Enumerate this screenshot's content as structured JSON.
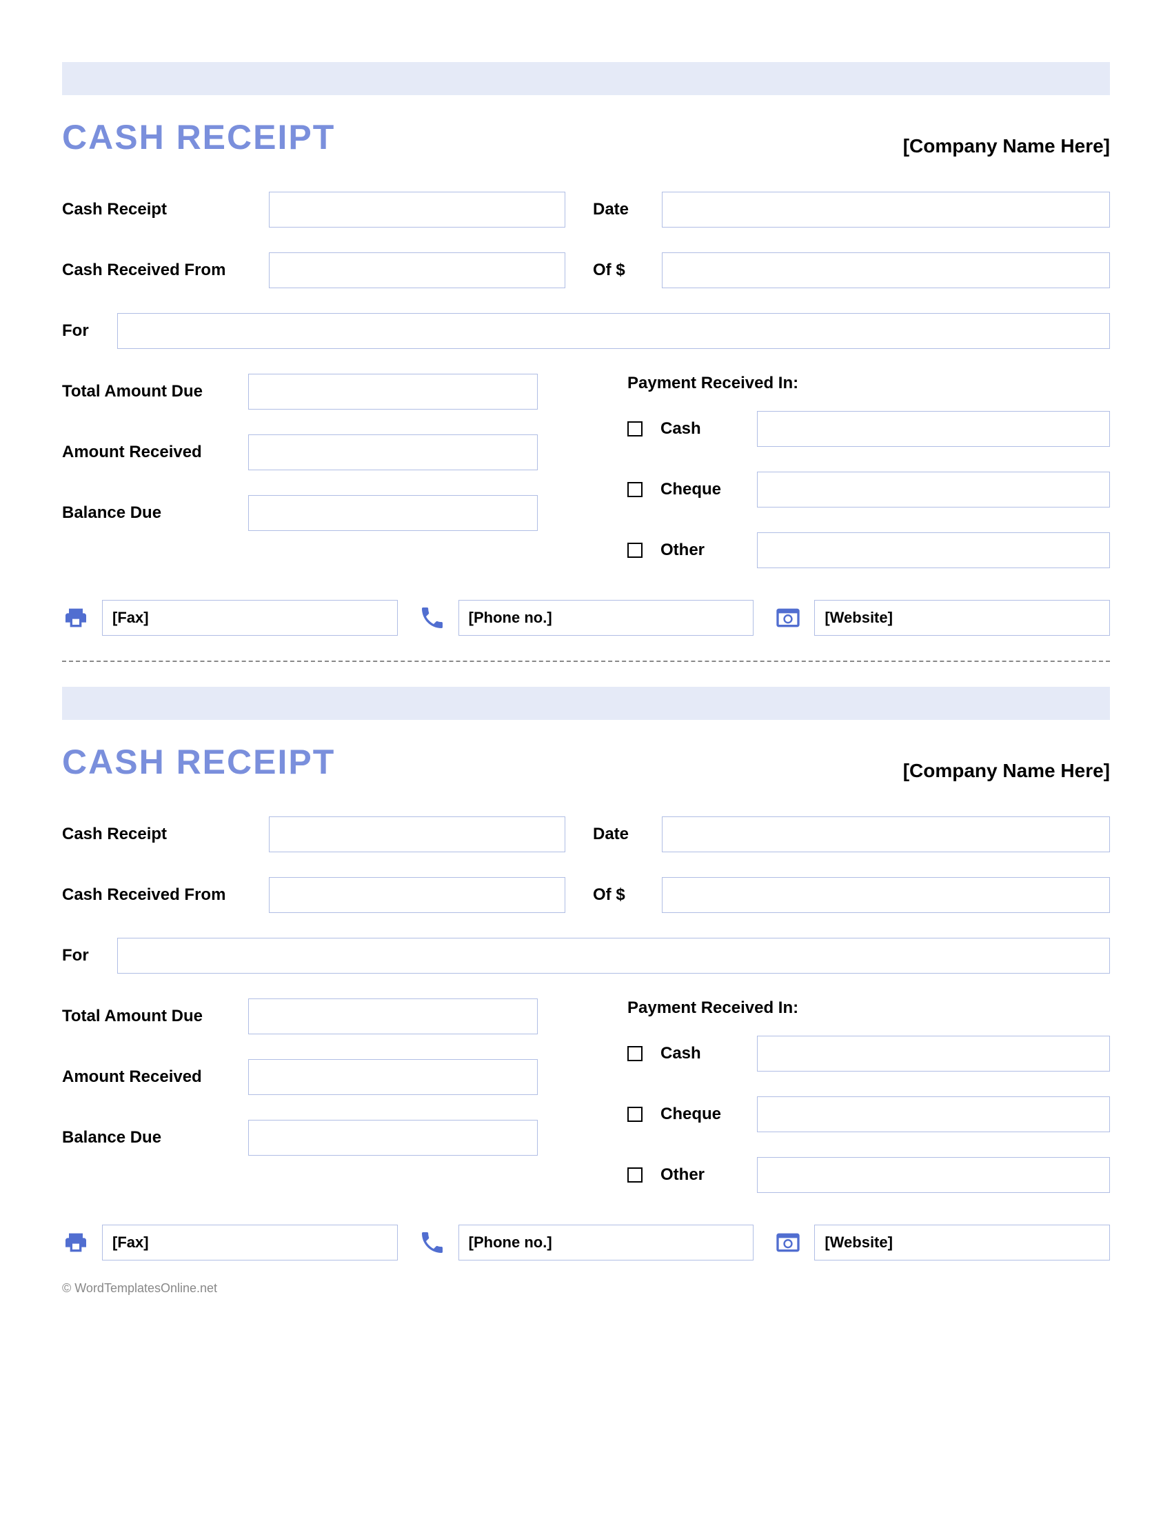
{
  "receipt": {
    "title": "CASH RECEIPT",
    "company": "[Company Name Here]",
    "labels": {
      "cashReceipt": "Cash Receipt",
      "date": "Date",
      "receivedFrom": "Cash Received From",
      "ofAmount": "Of $",
      "for": "For",
      "totalDue": "Total Amount Due",
      "amountReceived": "Amount Received",
      "balanceDue": "Balance Due",
      "paymentReceivedIn": "Payment Received In:",
      "cash": "Cash",
      "cheque": "Cheque",
      "other": "Other"
    },
    "contact": {
      "fax": "[Fax]",
      "phone": "[Phone no.]",
      "website": "[Website]"
    }
  },
  "footer": "© WordTemplatesOnline.net"
}
